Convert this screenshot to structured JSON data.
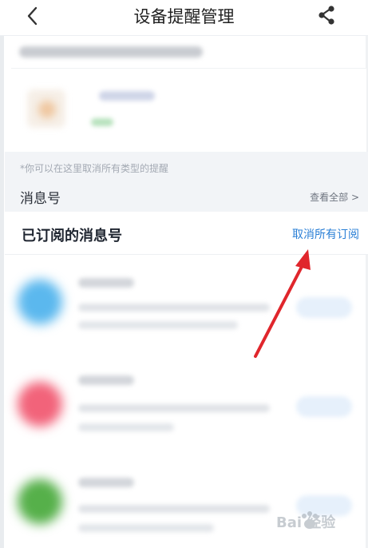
{
  "header": {
    "title": "设备提醒管理",
    "back_icon": "chevron-left-icon",
    "share_icon": "share-icon"
  },
  "info": {
    "hint": "*你可以在这里取消所有类型的提醒",
    "section_title": "消息号",
    "view_all": "查看全部 >"
  },
  "subscribed": {
    "title": "已订阅的消息号",
    "cancel_all": "取消所有订阅"
  },
  "list_colors": [
    "#5bb8ee",
    "#f2637a",
    "#56b04a"
  ],
  "colors": {
    "accent": "#2a7fd6",
    "arrow": "#e0262c",
    "section_bg": "#f2f4f7"
  },
  "watermark": {
    "text": "Bai 经验"
  }
}
